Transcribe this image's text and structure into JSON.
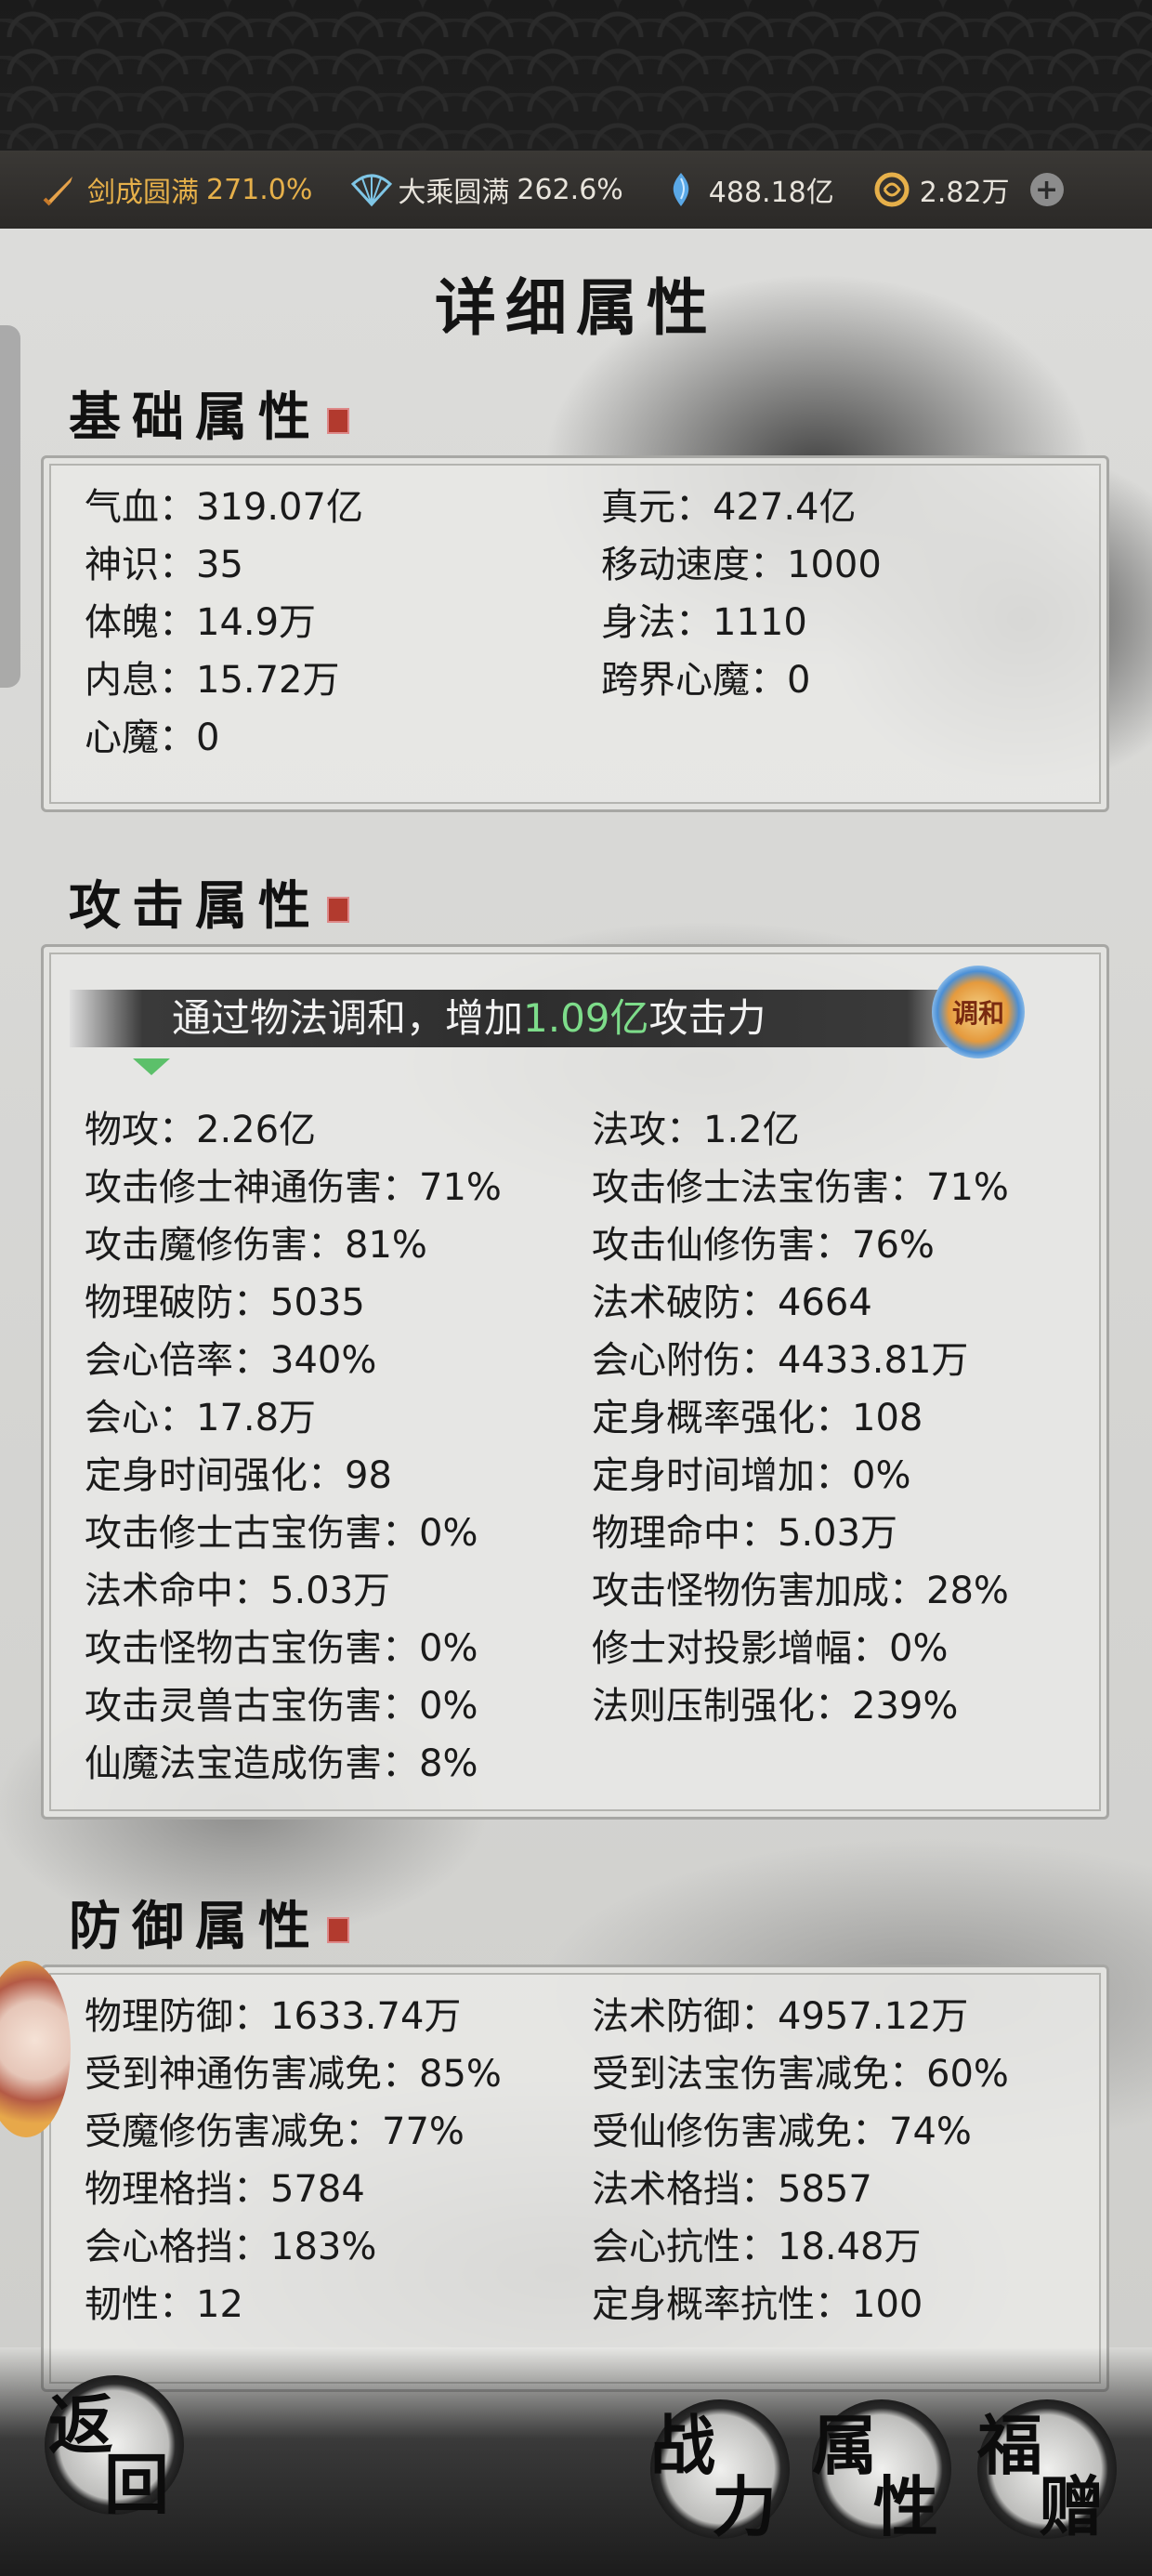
{
  "currency": {
    "items": [
      {
        "icon": "sword-icon",
        "label": "剑成圆满",
        "value": "271.0%"
      },
      {
        "icon": "fan-icon",
        "label": "大乘圆满",
        "value": "262.6%"
      },
      {
        "icon": "spirit-stone-icon",
        "label": "",
        "value": "488.18亿"
      },
      {
        "icon": "coin-icon",
        "label": "",
        "value": "2.82万"
      }
    ],
    "add_label": "+"
  },
  "page_title": "详细属性",
  "basic": {
    "title": "基础属性",
    "left": [
      "气血：319.07亿",
      "神识：35",
      "体魄：14.9万",
      "内息：15.72万",
      "心魔：0"
    ],
    "right": [
      "真元：427.4亿",
      "移动速度：1000",
      "身法：1110",
      "跨界心魔：0"
    ]
  },
  "attack": {
    "title": "攻击属性",
    "banner_prefix": "通过物法调和，增加",
    "banner_value": "1.09亿",
    "banner_suffix": "攻击力",
    "harmony_button": "调和",
    "left": [
      "物攻：2.26亿",
      "攻击修士神通伤害：71%",
      "攻击魔修伤害：81%",
      "物理破防：5035",
      "会心倍率：340%",
      "会心：17.8万",
      "定身时间强化：98",
      "攻击修士古宝伤害：0%",
      "法术命中：5.03万",
      "攻击怪物古宝伤害：0%",
      "攻击灵兽古宝伤害：0%",
      "仙魔法宝造成伤害：8%"
    ],
    "right": [
      "法攻：1.2亿",
      "攻击修士法宝伤害：71%",
      "攻击仙修伤害：76%",
      "法术破防：4664",
      "会心附伤：4433.81万",
      "定身概率强化：108",
      "定身时间增加：0%",
      "物理命中：5.03万",
      "攻击怪物伤害加成：28%",
      "修士对投影增幅：0%",
      "法则压制强化：239%"
    ]
  },
  "defense": {
    "title": "防御属性",
    "left": [
      "物理防御：1633.74万",
      "受到神通伤害减免：85%",
      "受魔修伤害减免：77%",
      "物理格挡：5784",
      "会心格挡：183%",
      "韧性：12"
    ],
    "right": [
      "法术防御：4957.12万",
      "受到法宝伤害减免：60%",
      "受仙修伤害减免：74%",
      "法术格挡：5857",
      "会心抗性：18.48万",
      "定身概率抗性：100"
    ]
  },
  "bottom": {
    "back": [
      "返",
      "回"
    ],
    "power": [
      "战",
      "力"
    ],
    "attr": [
      "属",
      "性"
    ],
    "gift": [
      "福",
      "赠"
    ]
  }
}
